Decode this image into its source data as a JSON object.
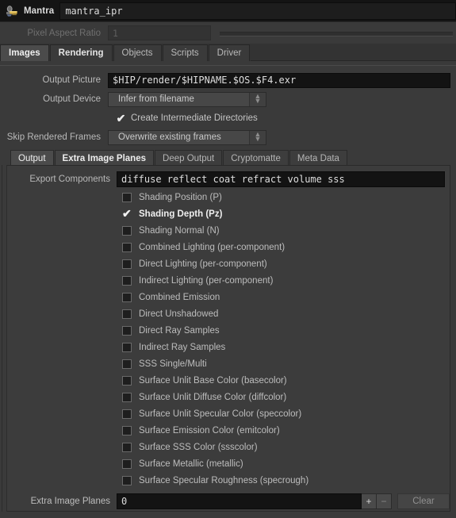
{
  "titlebar": {
    "icon": "mantra-node-icon",
    "node_type": "Mantra",
    "node_name": "mantra_ipr"
  },
  "pixel_aspect": {
    "label": "Pixel Aspect Ratio",
    "value": "1"
  },
  "top_tabs": [
    {
      "label": "Images",
      "state": "selected"
    },
    {
      "label": "Rendering",
      "state": "bold"
    },
    {
      "label": "Objects",
      "state": "normal"
    },
    {
      "label": "Scripts",
      "state": "normal"
    },
    {
      "label": "Driver",
      "state": "normal"
    }
  ],
  "output": {
    "picture_label": "Output Picture",
    "picture_value": "$HIP/render/$HIPNAME.$OS.$F4.exr",
    "device_label": "Output Device",
    "device_value": "Infer from filename",
    "intermediate_label": "Create Intermediate Directories",
    "intermediate_checked": true,
    "skip_label": "Skip Rendered Frames",
    "skip_value": "Overwrite existing frames"
  },
  "sub_tabs": [
    {
      "label": "Output",
      "state": "selected"
    },
    {
      "label": "Extra Image Planes",
      "state": "active"
    },
    {
      "label": "Deep Output",
      "state": "normal"
    },
    {
      "label": "Cryptomatte",
      "state": "normal"
    },
    {
      "label": "Meta Data",
      "state": "normal"
    }
  ],
  "export_components": {
    "label": "Export Components",
    "value": "diffuse reflect coat refract volume sss"
  },
  "planes": [
    {
      "label": "Shading Position (P)",
      "checked": false
    },
    {
      "label": "Shading Depth (Pz)",
      "checked": true
    },
    {
      "label": "Shading Normal (N)",
      "checked": false
    },
    {
      "label": "Combined Lighting (per-component)",
      "checked": false
    },
    {
      "label": "Direct Lighting (per-component)",
      "checked": false
    },
    {
      "label": "Indirect Lighting (per-component)",
      "checked": false
    },
    {
      "label": "Combined Emission",
      "checked": false
    },
    {
      "label": "Direct Unshadowed",
      "checked": false
    },
    {
      "label": "Direct Ray Samples",
      "checked": false
    },
    {
      "label": "Indirect Ray Samples",
      "checked": false
    },
    {
      "label": "SSS Single/Multi",
      "checked": false
    },
    {
      "label": "Surface Unlit Base Color (basecolor)",
      "checked": false
    },
    {
      "label": "Surface Unlit Diffuse Color (diffcolor)",
      "checked": false
    },
    {
      "label": "Surface Unlit Specular Color (speccolor)",
      "checked": false
    },
    {
      "label": "Surface Emission Color (emitcolor)",
      "checked": false
    },
    {
      "label": "Surface SSS Color (ssscolor)",
      "checked": false
    },
    {
      "label": "Surface Metallic (metallic)",
      "checked": false
    },
    {
      "label": "Surface Specular Roughness (specrough)",
      "checked": false
    }
  ],
  "extra_image_planes": {
    "label": "Extra Image Planes",
    "value": "0",
    "add_label": "+",
    "remove_label": "−",
    "clear_label": "Clear"
  },
  "colors": {
    "window_bg": "#3a3a3a",
    "titlebar_bg": "#141414",
    "field_bg": "#131313",
    "menu_bg": "#474747",
    "tab_selected_bg": "#4b4b4b",
    "text": "#c8c8c8",
    "text_disabled": "#6f6f6f",
    "icon_yellow": "#d9b44a",
    "icon_blue": "#6e7fa0"
  }
}
